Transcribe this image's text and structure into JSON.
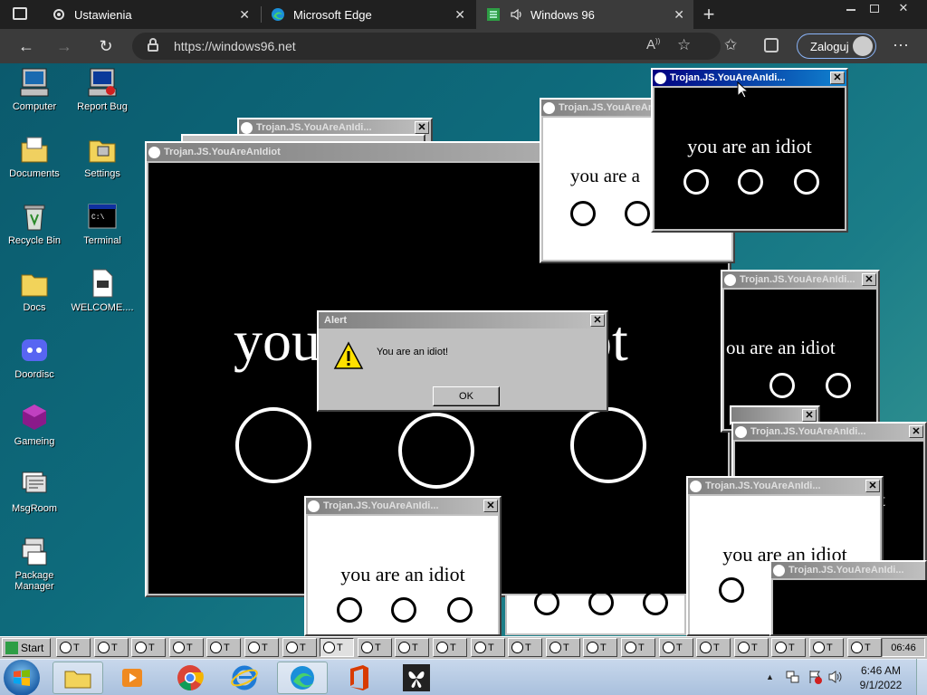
{
  "browser": {
    "tabs": [
      {
        "title": "Ustawienia",
        "icon": "gear-icon"
      },
      {
        "title": "Microsoft Edge",
        "icon": "edge-icon"
      },
      {
        "title": "Windows 96",
        "icon": "windows96-icon",
        "active": true
      }
    ],
    "url": "https://windows96.net",
    "login_label": "Zaloguj"
  },
  "desktop": {
    "icons_col1": [
      {
        "label": "Computer",
        "icon": "computer-icon"
      },
      {
        "label": "Documents",
        "icon": "documents-icon"
      },
      {
        "label": "Recycle Bin",
        "icon": "recycle-bin-icon"
      },
      {
        "label": "Docs",
        "icon": "folder-icon"
      },
      {
        "label": "Doordisc",
        "icon": "doordisc-icon"
      },
      {
        "label": "Gameing",
        "icon": "gameing-icon"
      },
      {
        "label": "MsgRoom",
        "icon": "msgroom-icon"
      },
      {
        "label": "Package Manager",
        "icon": "package-manager-icon"
      }
    ],
    "icons_col2": [
      {
        "label": "Report Bug",
        "icon": "report-bug-icon"
      },
      {
        "label": "Settings",
        "icon": "settings-icon"
      },
      {
        "label": "Terminal",
        "icon": "terminal-icon"
      },
      {
        "label": "WELCOME....",
        "icon": "markdown-file-icon"
      }
    ]
  },
  "trojan": {
    "title_full": "Trojan.JS.YouAreAnIdiot",
    "title_short": "Trojan.JS.YouAreAnIdi...",
    "text": "you are an idiot",
    "text_cut_a": "you are a",
    "text_cut_b": "ou are an idiot",
    "big_left": "you",
    "big_right": "ot"
  },
  "alert": {
    "title": "Alert",
    "message": "You are an idiot!",
    "ok_label": "OK",
    "close_label": "✕"
  },
  "taskbar96": {
    "start_label": "Start",
    "task_label": "T",
    "clock": "06:46"
  },
  "win7": {
    "time": "6:46 AM",
    "date": "9/1/2022"
  }
}
